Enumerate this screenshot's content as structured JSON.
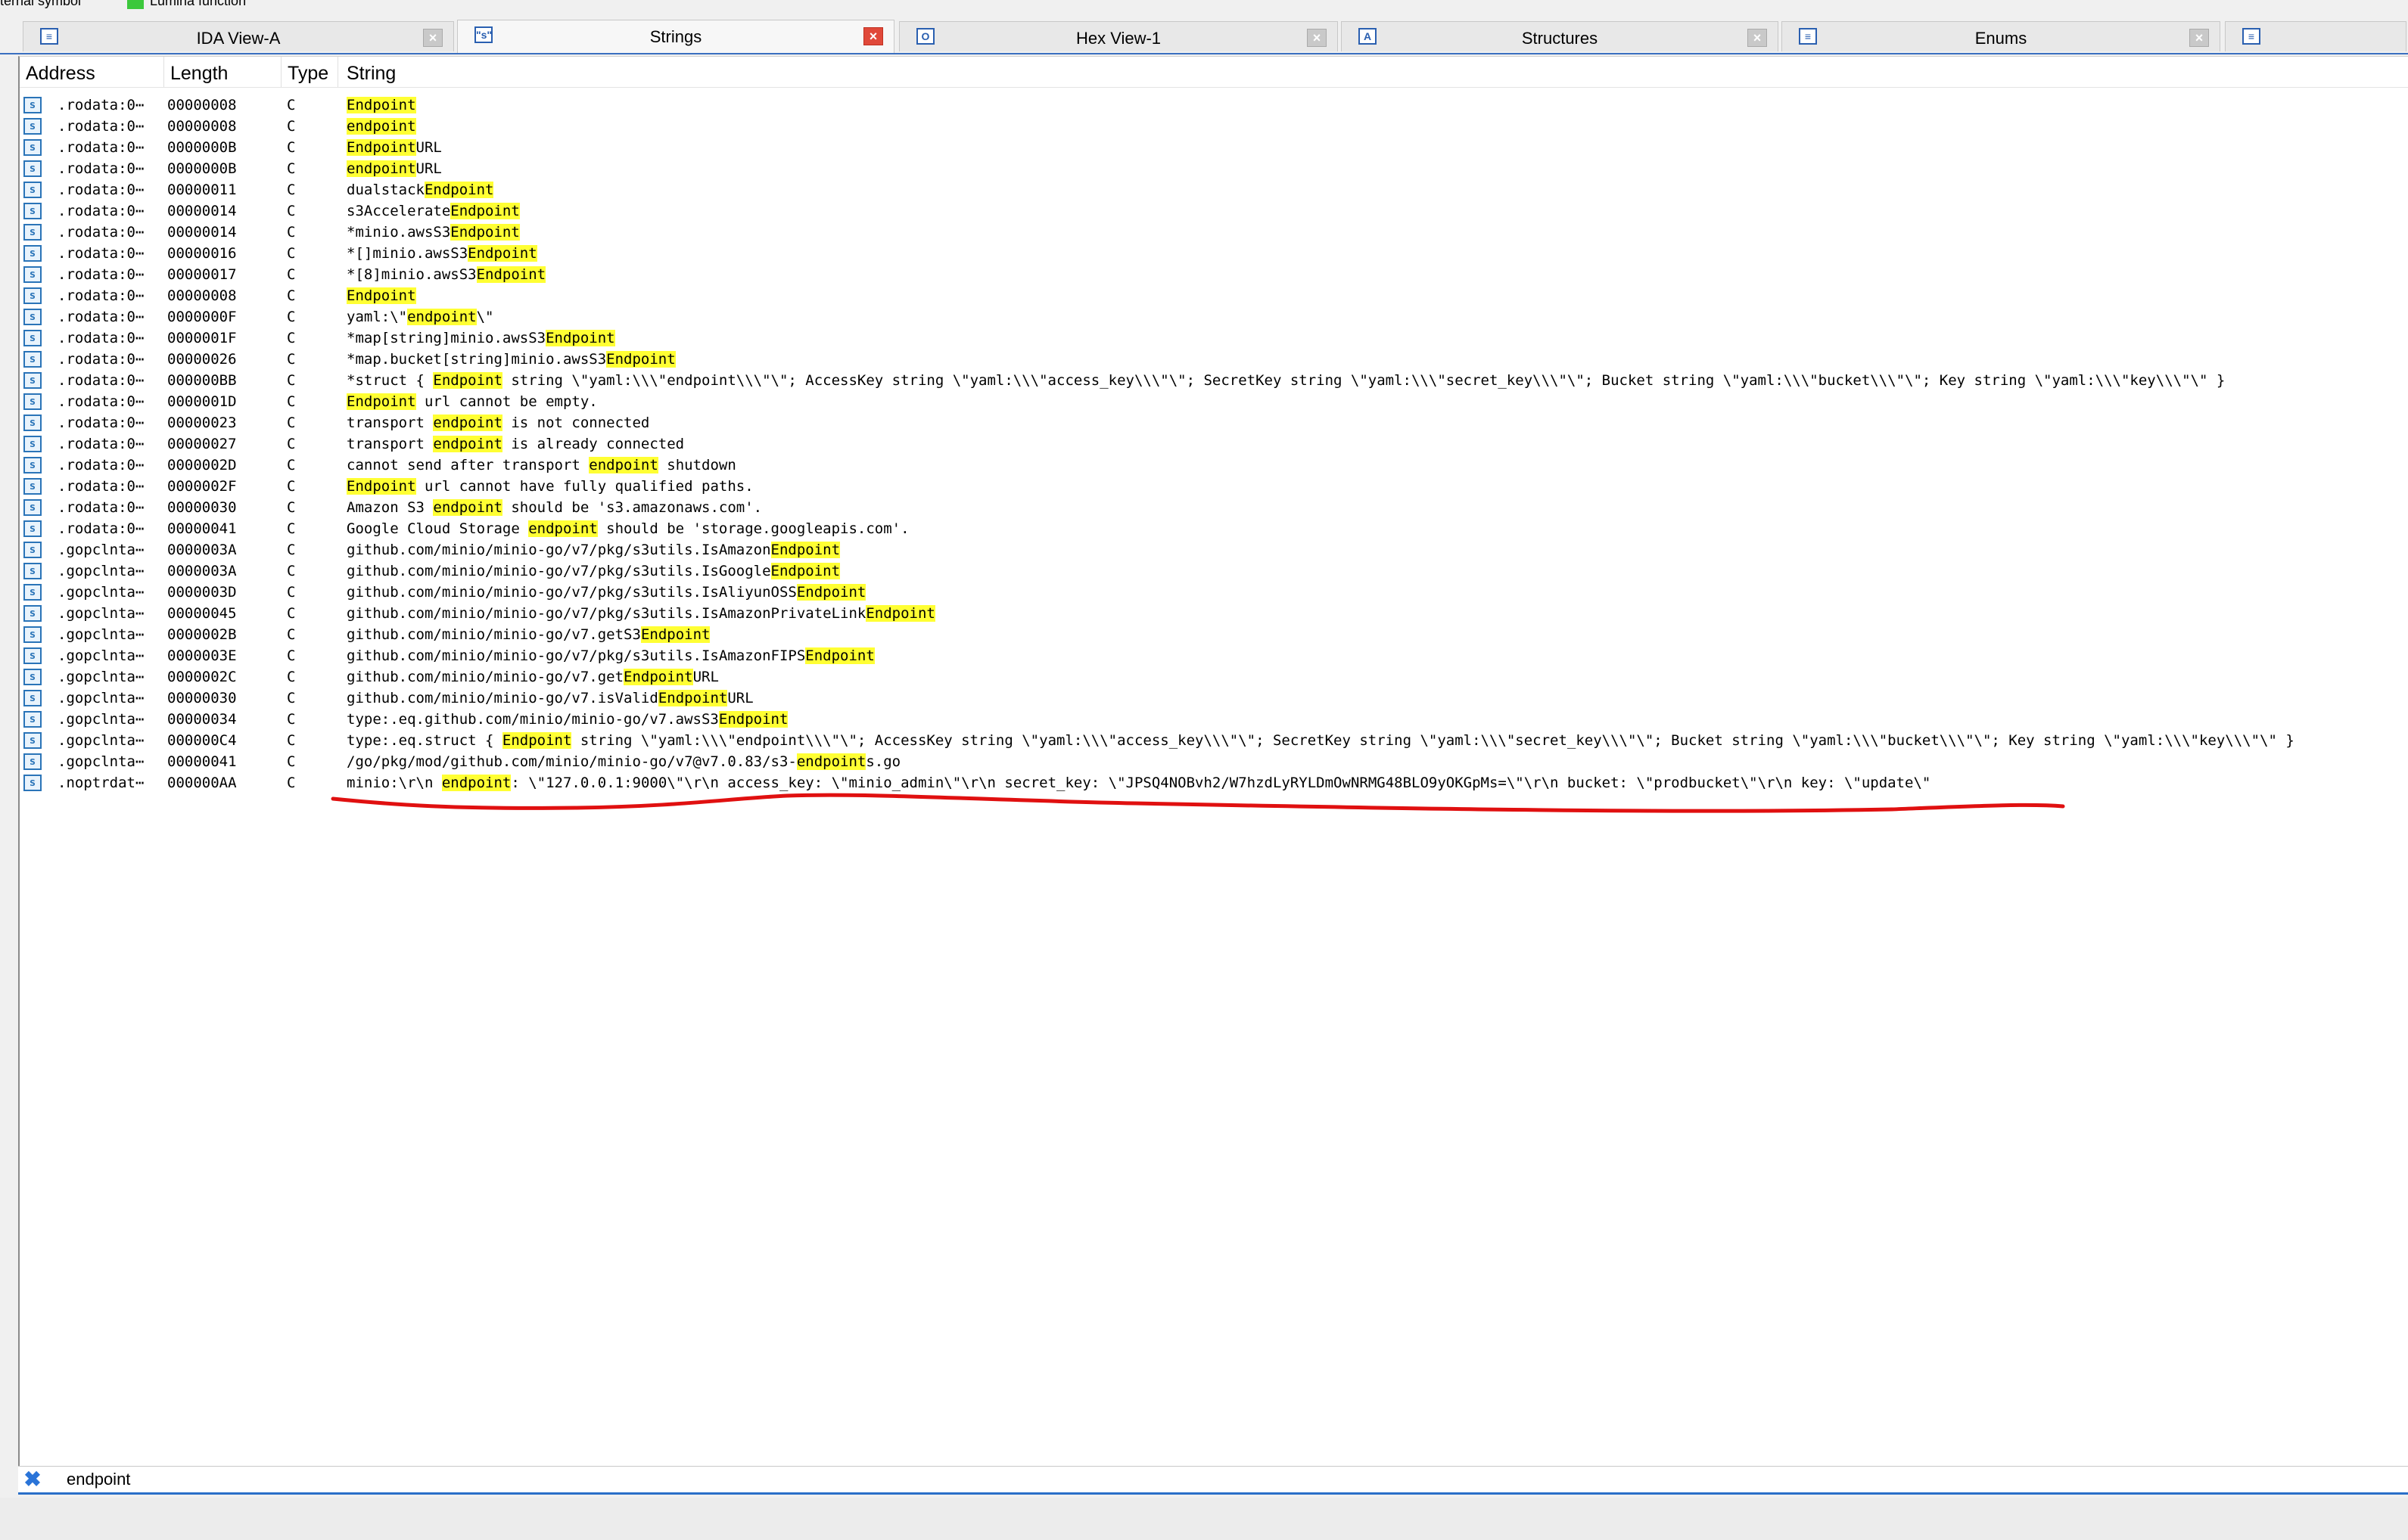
{
  "legend": {
    "items": [
      {
        "label": "ternal symbol",
        "color": ""
      },
      {
        "label": "Lumina function",
        "color": "#3cc83c"
      }
    ]
  },
  "tabs": [
    {
      "label": "IDA View-A",
      "icon": "ida-view-icon",
      "glyph": "≡",
      "active": false
    },
    {
      "label": "Strings",
      "icon": "strings-icon",
      "glyph": "\"s\"",
      "active": true
    },
    {
      "label": "Hex View-1",
      "icon": "hex-view-icon",
      "glyph": "O",
      "active": false
    },
    {
      "label": "Structures",
      "icon": "structures-icon",
      "glyph": "A",
      "active": false
    },
    {
      "label": "Enums",
      "icon": "enums-icon",
      "glyph": "≡",
      "active": false
    },
    {
      "label": "",
      "icon": "imports-icon",
      "glyph": "≡",
      "active": false
    }
  ],
  "close_glyph": "×",
  "columns": {
    "address": "Address",
    "length": "Length",
    "type": "Type",
    "string": "String"
  },
  "row_icon_glyph": "s",
  "highlight_color": "#ffff33",
  "rows": [
    {
      "address": ".rodata:0⋯",
      "length": "00000008",
      "type": "C",
      "string": [
        [
          "Endpoint",
          true
        ]
      ]
    },
    {
      "address": ".rodata:0⋯",
      "length": "00000008",
      "type": "C",
      "string": [
        [
          "endpoint",
          true
        ]
      ]
    },
    {
      "address": ".rodata:0⋯",
      "length": "0000000B",
      "type": "C",
      "string": [
        [
          "Endpoint",
          true
        ],
        [
          "URL",
          false
        ]
      ]
    },
    {
      "address": ".rodata:0⋯",
      "length": "0000000B",
      "type": "C",
      "string": [
        [
          "endpoint",
          true
        ],
        [
          "URL",
          false
        ]
      ]
    },
    {
      "address": ".rodata:0⋯",
      "length": "00000011",
      "type": "C",
      "string": [
        [
          "dualstack",
          false
        ],
        [
          "Endpoint",
          true
        ]
      ]
    },
    {
      "address": ".rodata:0⋯",
      "length": "00000014",
      "type": "C",
      "string": [
        [
          "s3Accelerate",
          false
        ],
        [
          "Endpoint",
          true
        ]
      ]
    },
    {
      "address": ".rodata:0⋯",
      "length": "00000014",
      "type": "C",
      "string": [
        [
          "*minio.awsS3",
          false
        ],
        [
          "Endpoint",
          true
        ]
      ]
    },
    {
      "address": ".rodata:0⋯",
      "length": "00000016",
      "type": "C",
      "string": [
        [
          "*[]minio.awsS3",
          false
        ],
        [
          "Endpoint",
          true
        ]
      ]
    },
    {
      "address": ".rodata:0⋯",
      "length": "00000017",
      "type": "C",
      "string": [
        [
          "*[8]minio.awsS3",
          false
        ],
        [
          "Endpoint",
          true
        ]
      ]
    },
    {
      "address": ".rodata:0⋯",
      "length": "00000008",
      "type": "C",
      "string": [
        [
          "Endpoint",
          true
        ]
      ]
    },
    {
      "address": ".rodata:0⋯",
      "length": "0000000F",
      "type": "C",
      "string": [
        [
          "yaml:\\\"",
          false
        ],
        [
          "endpoint",
          true
        ],
        [
          "\\\"",
          false
        ]
      ]
    },
    {
      "address": ".rodata:0⋯",
      "length": "0000001F",
      "type": "C",
      "string": [
        [
          "*map[string]minio.awsS3",
          false
        ],
        [
          "Endpoint",
          true
        ]
      ]
    },
    {
      "address": ".rodata:0⋯",
      "length": "00000026",
      "type": "C",
      "string": [
        [
          "*map.bucket[string]minio.awsS3",
          false
        ],
        [
          "Endpoint",
          true
        ]
      ]
    },
    {
      "address": ".rodata:0⋯",
      "length": "000000BB",
      "type": "C",
      "string": [
        [
          "*struct { ",
          false
        ],
        [
          "Endpoint",
          true
        ],
        [
          " string \\\"yaml:\\\\\\\"endpoint\\\\\\\"\\\"; AccessKey string \\\"yaml:\\\\\\\"access_key\\\\\\\"\\\"; SecretKey string \\\"yaml:\\\\\\\"secret_key\\\\\\\"\\\"; Bucket string \\\"yaml:\\\\\\\"bucket\\\\\\\"\\\"; Key string \\\"yaml:\\\\\\\"key\\\\\\\"\\\" }",
          false
        ]
      ]
    },
    {
      "address": ".rodata:0⋯",
      "length": "0000001D",
      "type": "C",
      "string": [
        [
          "Endpoint",
          true
        ],
        [
          " url cannot be empty.",
          false
        ]
      ]
    },
    {
      "address": ".rodata:0⋯",
      "length": "00000023",
      "type": "C",
      "string": [
        [
          "transport ",
          false
        ],
        [
          "endpoint",
          true
        ],
        [
          " is not connected",
          false
        ]
      ]
    },
    {
      "address": ".rodata:0⋯",
      "length": "00000027",
      "type": "C",
      "string": [
        [
          "transport ",
          false
        ],
        [
          "endpoint",
          true
        ],
        [
          " is already connected",
          false
        ]
      ]
    },
    {
      "address": ".rodata:0⋯",
      "length": "0000002D",
      "type": "C",
      "string": [
        [
          "cannot send after transport ",
          false
        ],
        [
          "endpoint",
          true
        ],
        [
          " shutdown",
          false
        ]
      ]
    },
    {
      "address": ".rodata:0⋯",
      "length": "0000002F",
      "type": "C",
      "string": [
        [
          "Endpoint",
          true
        ],
        [
          " url cannot have fully qualified paths.",
          false
        ]
      ]
    },
    {
      "address": ".rodata:0⋯",
      "length": "00000030",
      "type": "C",
      "string": [
        [
          "Amazon S3 ",
          false
        ],
        [
          "endpoint",
          true
        ],
        [
          " should be 's3.amazonaws.com'.",
          false
        ]
      ]
    },
    {
      "address": ".rodata:0⋯",
      "length": "00000041",
      "type": "C",
      "string": [
        [
          "Google Cloud Storage ",
          false
        ],
        [
          "endpoint",
          true
        ],
        [
          " should be 'storage.googleapis.com'.",
          false
        ]
      ]
    },
    {
      "address": ".gopclnta⋯",
      "length": "0000003A",
      "type": "C",
      "string": [
        [
          "github.com/minio/minio-go/v7/pkg/s3utils.IsAmazon",
          false
        ],
        [
          "Endpoint",
          true
        ]
      ]
    },
    {
      "address": ".gopclnta⋯",
      "length": "0000003A",
      "type": "C",
      "string": [
        [
          "github.com/minio/minio-go/v7/pkg/s3utils.IsGoogle",
          false
        ],
        [
          "Endpoint",
          true
        ]
      ]
    },
    {
      "address": ".gopclnta⋯",
      "length": "0000003D",
      "type": "C",
      "string": [
        [
          "github.com/minio/minio-go/v7/pkg/s3utils.IsAliyunOSS",
          false
        ],
        [
          "Endpoint",
          true
        ]
      ]
    },
    {
      "address": ".gopclnta⋯",
      "length": "00000045",
      "type": "C",
      "string": [
        [
          "github.com/minio/minio-go/v7/pkg/s3utils.IsAmazonPrivateLink",
          false
        ],
        [
          "Endpoint",
          true
        ]
      ]
    },
    {
      "address": ".gopclnta⋯",
      "length": "0000002B",
      "type": "C",
      "string": [
        [
          "github.com/minio/minio-go/v7.getS3",
          false
        ],
        [
          "Endpoint",
          true
        ]
      ]
    },
    {
      "address": ".gopclnta⋯",
      "length": "0000003E",
      "type": "C",
      "string": [
        [
          "github.com/minio/minio-go/v7/pkg/s3utils.IsAmazonFIPS",
          false
        ],
        [
          "Endpoint",
          true
        ]
      ]
    },
    {
      "address": ".gopclnta⋯",
      "length": "0000002C",
      "type": "C",
      "string": [
        [
          "github.com/minio/minio-go/v7.get",
          false
        ],
        [
          "Endpoint",
          true
        ],
        [
          "URL",
          false
        ]
      ]
    },
    {
      "address": ".gopclnta⋯",
      "length": "00000030",
      "type": "C",
      "string": [
        [
          "github.com/minio/minio-go/v7.isValid",
          false
        ],
        [
          "Endpoint",
          true
        ],
        [
          "URL",
          false
        ]
      ]
    },
    {
      "address": ".gopclnta⋯",
      "length": "00000034",
      "type": "C",
      "string": [
        [
          "type:.eq.github.com/minio/minio-go/v7.awsS3",
          false
        ],
        [
          "Endpoint",
          true
        ]
      ]
    },
    {
      "address": ".gopclnta⋯",
      "length": "000000C4",
      "type": "C",
      "string": [
        [
          "type:.eq.struct { ",
          false
        ],
        [
          "Endpoint",
          true
        ],
        [
          " string \\\"yaml:\\\\\\\"endpoint\\\\\\\"\\\"; AccessKey string \\\"yaml:\\\\\\\"access_key\\\\\\\"\\\"; SecretKey string \\\"yaml:\\\\\\\"secret_key\\\\\\\"\\\"; Bucket string \\\"yaml:\\\\\\\"bucket\\\\\\\"\\\"; Key string \\\"yaml:\\\\\\\"key\\\\\\\"\\\" }",
          false
        ]
      ]
    },
    {
      "address": ".gopclnta⋯",
      "length": "00000041",
      "type": "C",
      "string": [
        [
          "/go/pkg/mod/github.com/minio/minio-go/v7@v7.0.83/s3-",
          false
        ],
        [
          "endpoint",
          true
        ],
        [
          "s.go",
          false
        ]
      ]
    },
    {
      "address": ".noptrdat⋯",
      "length": "000000AA",
      "type": "C",
      "string": [
        [
          "minio:\\r\\n  ",
          false
        ],
        [
          "endpoint",
          true
        ],
        [
          ": \\\"127.0.0.1:9000\\\"\\r\\n  access_key: \\\"minio_admin\\\"\\r\\n  secret_key: \\\"JPSQ4NOBvh2/W7hzdLyRYLDmOwNRMG48BLO9yOKGpMs=\\\"\\r\\n  bucket: \\\"prodbucket\\\"\\r\\n  key: \\\"update\\\"",
          false
        ]
      ]
    }
  ],
  "filter": {
    "value": "endpoint",
    "clear_icon": "close-filter-icon",
    "glyph": "✖"
  }
}
